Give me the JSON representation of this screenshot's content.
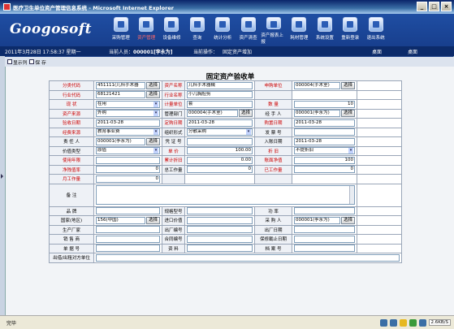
{
  "window": {
    "title": "医疗卫生单位资产管理信息系统 - Microsoft Internet Explorer",
    "min": "_",
    "max": "□",
    "close": "×"
  },
  "header": {
    "logo": "Googosoft",
    "nav": [
      {
        "label": "采购管理",
        "icon": "cart-icon",
        "active": false
      },
      {
        "label": "资产管理",
        "icon": "assets-icon",
        "active": true
      },
      {
        "label": "设备维修",
        "icon": "wrench-icon",
        "active": false
      },
      {
        "label": "查询",
        "icon": "search-icon",
        "active": false
      },
      {
        "label": "统计分析",
        "icon": "chart-icon",
        "active": false
      },
      {
        "label": "资产清查",
        "icon": "checklist-icon",
        "active": false
      },
      {
        "label": "资产报表上报",
        "icon": "report-icon",
        "active": false
      },
      {
        "label": "耗材管理",
        "icon": "supplies-icon",
        "active": false
      },
      {
        "label": "系统设置",
        "icon": "settings-icon",
        "active": false
      },
      {
        "label": "重新登录",
        "icon": "relogin-icon",
        "active": false
      },
      {
        "label": "退出系统",
        "icon": "exit-icon",
        "active": false
      }
    ]
  },
  "infobar": {
    "datetime": "2011年3月28日 17:58:37 星期一",
    "current_user_label": "当前人员：",
    "current_user": "000001[李永为]",
    "current_op_label": "当前操作：",
    "current_op": "固定资产增加",
    "right1": "桌面",
    "right2": "桌面"
  },
  "toolbar": {
    "show_list": "显示列",
    "save": "保 存"
  },
  "form": {
    "title": "固定资产验收单",
    "select_btn": "选择",
    "labels": {
      "class_code": "分类代码",
      "asset_name": "资产名称",
      "dept": "申购单位",
      "industry_code": "行业代码",
      "industry_name": "行业名称",
      "status": "现 状",
      "unit": "计量单位",
      "quantity": "数 量",
      "source": "资产来源",
      "mgmt_dept": "管理部门",
      "handler": "经 手 人",
      "acceptance_date": "验收日期",
      "voucher_date": "定购日期",
      "purchase_date": "购置日期",
      "funding": "经费来源",
      "org_form": "组织形式",
      "invoice": "发 票 号",
      "custodian": "责 任 人",
      "cert_no": "凭 证 号",
      "account_date": "入账日期",
      "value_type": "价值类型",
      "unit_price": "单 价",
      "depreciation": "折 旧",
      "service_years": "使用年限",
      "accum_dep": "累计折旧",
      "book_value": "账面净值",
      "net_residual": "净残值率",
      "total_work": "总工作量",
      "done_work": "已工作量",
      "monthly_work": "月工作量",
      "remarks": "备 注",
      "brand": "品 牌",
      "spec": "规格型号",
      "power": "功 率",
      "country": "国家(地区)",
      "import_price": "进口价值",
      "buyer": "采 购 人",
      "manufacturer": "生产厂家",
      "factory_no": "出厂编号",
      "factory_date": "出厂日期",
      "seller": "销 售 商",
      "contract_no": "合同编号",
      "warranty": "保修截止日期",
      "doc_no": "单 据 号",
      "material": "资 料",
      "archive_no": "档 案 号",
      "sub_unit": "出借/出租对方单位"
    },
    "values": {
      "class_code": "451111(儿科手术器",
      "asset_name": "儿科手术器械",
      "dept": "000004(手术室)",
      "industry_code": "68121421",
      "industry_name": "小儿胸腔剪",
      "status": "在用",
      "unit": "套",
      "quantity": "10",
      "source": "外购",
      "mgmt_dept": "000004(手术室)",
      "handler": "000001(李永为)",
      "acceptance_date": "2011-03-28",
      "voucher_date": "2011-03-28",
      "purchase_date": "2011-03-28",
      "funding": "教育事业费",
      "org_form": "分散采购",
      "invoice": "",
      "custodian": "000001(李永为)",
      "cert_no": "",
      "account_date": "2011-03-28",
      "value_type": "原值",
      "unit_price": "100.00",
      "depreciation": "不提折旧",
      "service_years": "",
      "accum_dep": "0.00",
      "book_value": "100",
      "net_residual": "0",
      "total_work": "0",
      "done_work": "0",
      "monthly_work": "0",
      "remarks": "",
      "brand": "",
      "spec": "",
      "power": "",
      "country": "156(中国)",
      "import_price": "",
      "buyer": "000001(李永为)",
      "manufacturer": "",
      "factory_no": "",
      "factory_date": "",
      "seller": "",
      "contract_no": "",
      "warranty": "",
      "doc_no": "",
      "material": "",
      "archive_no": "",
      "sub_unit": ""
    }
  },
  "statusbar": {
    "done": "完毕",
    "speed": "2.6KB/S"
  }
}
